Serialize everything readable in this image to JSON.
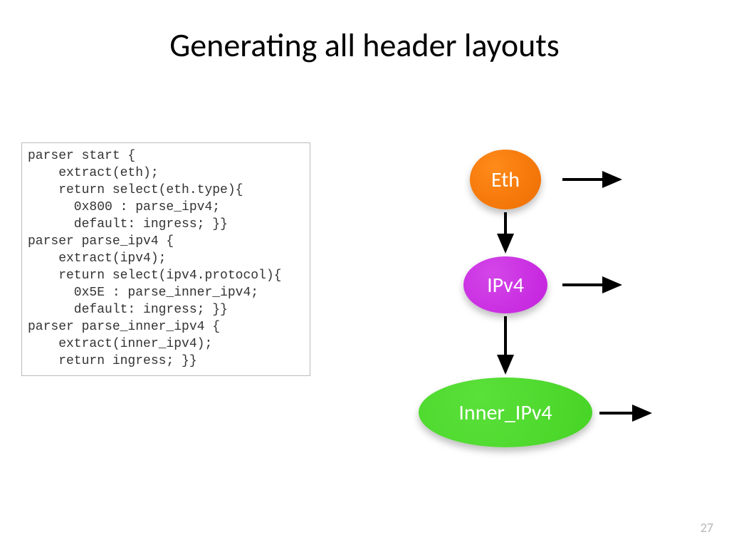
{
  "title": "Generating all header layouts",
  "code": "parser start {\n    extract(eth);\n    return select(eth.type){\n      0x800 : parse_ipv4;\n      default: ingress; }}\nparser parse_ipv4 {\n    extract(ipv4);\n    return select(ipv4.protocol){\n      0x5E : parse_inner_ipv4;\n      default: ingress; }}\nparser parse_inner_ipv4 {\n    extract(inner_ipv4);\n    return ingress; }}",
  "nodes": {
    "eth": "Eth",
    "ipv4": "IPv4",
    "inner_ipv4": "Inner_IPv4"
  },
  "pageNumber": "27",
  "diagram": {
    "edges": [
      {
        "from": "Eth",
        "to": "out"
      },
      {
        "from": "Eth",
        "to": "IPv4"
      },
      {
        "from": "IPv4",
        "to": "out"
      },
      {
        "from": "IPv4",
        "to": "Inner_IPv4"
      },
      {
        "from": "Inner_IPv4",
        "to": "out"
      }
    ],
    "colors": {
      "Eth": "#ed6d00",
      "IPv4": "#c320dd",
      "Inner_IPv4": "#47d425"
    }
  }
}
